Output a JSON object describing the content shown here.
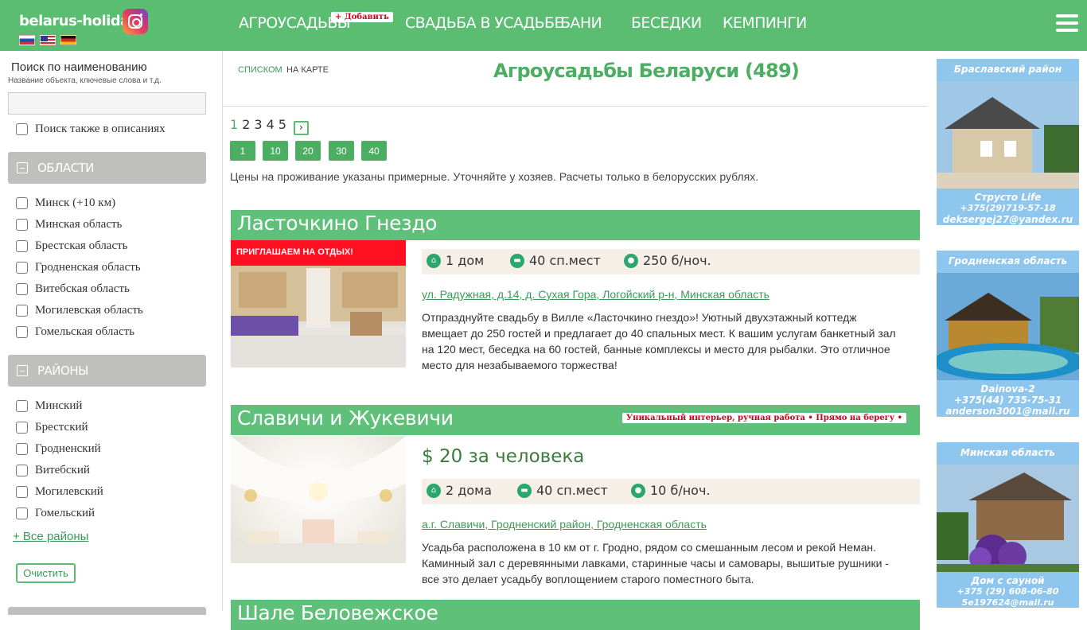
{
  "header": {
    "logo": "belarus-holiday",
    "nav": [
      {
        "label": "Агроусадьбы"
      },
      {
        "label": "Свадьба в усадьбе"
      },
      {
        "label": "Бани"
      },
      {
        "label": "Беседки"
      },
      {
        "label": "Кемпинги"
      }
    ],
    "add_badge": "+ Добавить"
  },
  "sidebar": {
    "search_title": "Поиск по наименованию",
    "search_subtitle": "Название объекта, ключевые слова и т.д.",
    "search_value": "",
    "search_descriptions_label": "Поиск также в описаниях",
    "regions_title": "ОБЛАСТИ",
    "regions": [
      "Минск (+10 км)",
      "Минская область",
      "Брестская область",
      "Гродненская область",
      "Витебская область",
      "Могилевская область",
      "Гомельская область"
    ],
    "districts_title": "РАЙОНЫ",
    "districts": [
      "Минский",
      "Брестский",
      "Гродненский",
      "Витебский",
      "Могилевский",
      "Гомельский"
    ],
    "all_districts_link": "+ Все районы",
    "clear_button": "Очистить"
  },
  "main": {
    "view_list": "СПИСКОМ",
    "view_map": "НА КАРТЕ",
    "title": "Агроусадьбы Беларуси (489)",
    "pages": [
      "1",
      "2",
      "3",
      "4",
      "5"
    ],
    "next_glyph": "›",
    "per_page": [
      "1",
      "10",
      "20",
      "30",
      "40"
    ],
    "notice": "Цены на проживание указаны примерные. Уточняйте у хозяев. Расчеты только в белорусских рублях.",
    "listings": [
      {
        "title": "Ласточкино Гнездо",
        "promo": "ПРИГЛАШАЕМ НА ОТДЫХ!",
        "houses": "1 дом",
        "beds": "40 сп.мест",
        "price_night": "250 б/ноч.",
        "address": "ул. Радужная, д.14, д. Сухая Гора, Логойский р-н, Минская область",
        "description": "Отпразднуйте свадьбу в Вилле «Ласточкино гнездо»! Уютный двухэтажный коттедж вмещает до 250 гостей и предлагает до 40 спальных мест. К вашим услугам банкетный зал на 120 мест, беседка на 60 гостей, банные комплексы и место для рыбалки. Это отличное место для незабываемого торжества!"
      },
      {
        "title": "Славичи и Жукевичи",
        "tags": "Уникальный интерьер, ручная работа • Прямо на берегу •",
        "price": "$ 20 за человека",
        "houses": "2 дома",
        "beds": "40 сп.мест",
        "price_night": "10 б/ноч.",
        "address": "а.г. Славичи, Гродненский район, Гродненская область",
        "description": "Усадьба расположена в 10 км от г. Гродно, рядом со смешанным лесом и рекой Неман. Каминный зал с деревянными лавками, старинные часы и самовары, вышитые рушники - все это делает усадьбу воплощением старого поместного быта."
      },
      {
        "title": "Шале Беловежское"
      }
    ]
  },
  "ads": [
    {
      "top": "Браславский район",
      "lines": [
        "Струсто Life",
        "+375(29)719-57-18",
        "deksergej27@yandex.ru"
      ]
    },
    {
      "top": "Гродненская область",
      "lines": [
        "Dainova-2",
        "+375(44) 735-75-31",
        "anderson3001@mail.ru"
      ]
    },
    {
      "top": "Минская область",
      "lines": [
        "Дом с сауной",
        "+375 (29) 608-06-80",
        "5e197624@mail.ru"
      ]
    }
  ],
  "colors": {
    "brand_green": "#5bbd72",
    "link_green": "#3a9a56",
    "promo_red": "#ff0f1f"
  }
}
